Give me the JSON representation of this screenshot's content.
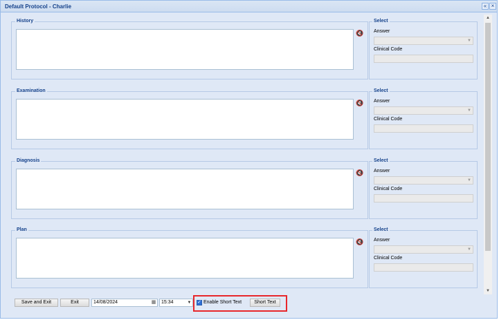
{
  "window": {
    "title": "Default Protocol - Charlie",
    "min_icon": "«",
    "close_icon": "×"
  },
  "sections": [
    {
      "label": "History",
      "select_label": "Select",
      "answer_label": "Answer",
      "code_label": "Clinical Code"
    },
    {
      "label": "Examination",
      "select_label": "Select",
      "answer_label": "Answer",
      "code_label": "Clinical Code"
    },
    {
      "label": "Diagnosis",
      "select_label": "Select",
      "answer_label": "Answer",
      "code_label": "Clinical Code"
    },
    {
      "label": "Plan",
      "select_label": "Select",
      "answer_label": "Answer",
      "code_label": "Clinical Code"
    }
  ],
  "icons": {
    "mic": "microphone-off-icon",
    "calendar": "calendar-icon"
  },
  "footer": {
    "save_exit": "Save and Exit",
    "exit": "Exit",
    "date": "14/08/2024",
    "time": "15:34",
    "enable_short_text": "Enable Short Text",
    "enable_short_text_checked": true,
    "short_text": "Short Text"
  }
}
